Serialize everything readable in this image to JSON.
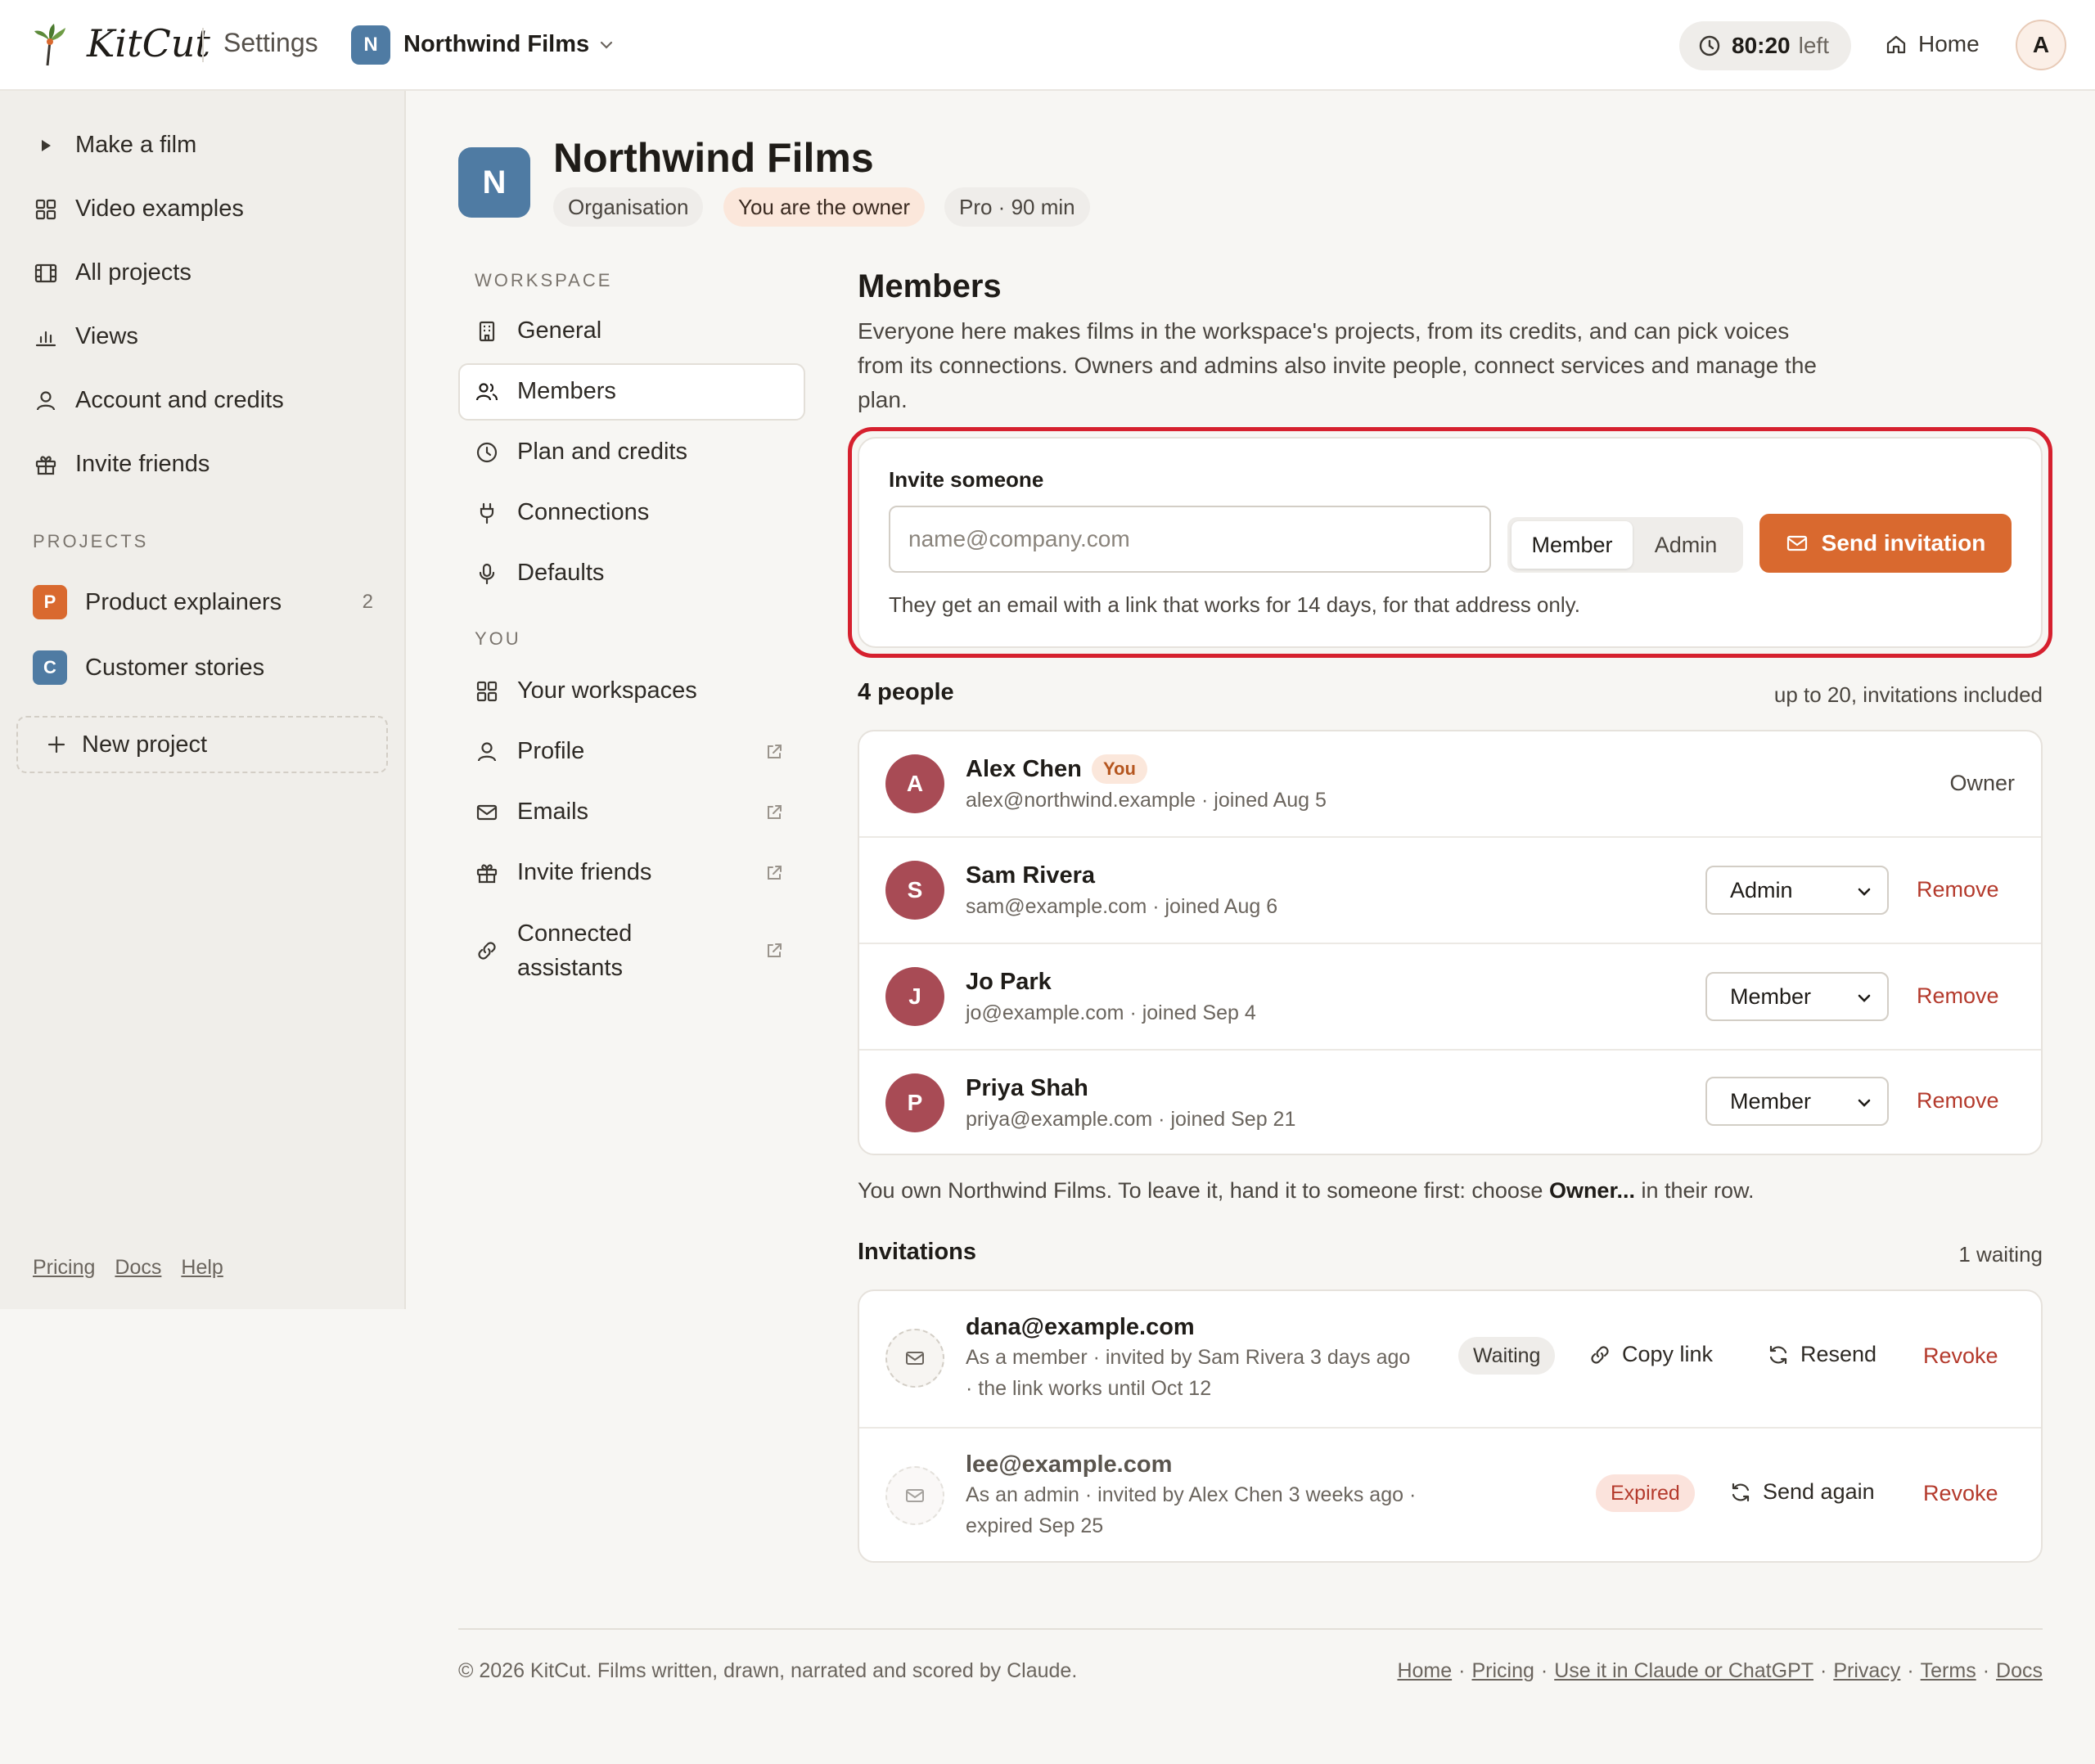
{
  "topbar": {
    "brand": "KitCut",
    "section": "Settings",
    "workspace_initial": "N",
    "workspace_name": "Northwind Films",
    "timer_value": "80:20",
    "timer_suffix": "left",
    "home_label": "Home",
    "avatar_initial": "A"
  },
  "sidebar": {
    "items": [
      {
        "label": "Make a film",
        "icon": "play-icon"
      },
      {
        "label": "Video examples",
        "icon": "grid-icon"
      },
      {
        "label": "All projects",
        "icon": "film-icon"
      },
      {
        "label": "Views",
        "icon": "bar-chart-icon"
      },
      {
        "label": "Account and credits",
        "icon": "user-icon"
      },
      {
        "label": "Invite friends",
        "icon": "gift-icon"
      }
    ],
    "projects_heading": "PROJECTS",
    "projects": [
      {
        "initial": "P",
        "label": "Product explainers",
        "count": "2",
        "color": "#d9692f"
      },
      {
        "initial": "C",
        "label": "Customer stories",
        "count": "",
        "color": "#4f7ba3"
      }
    ],
    "new_project_label": "New project",
    "footer_links": [
      "Pricing",
      "Docs",
      "Help"
    ]
  },
  "org": {
    "initial": "N",
    "name": "Northwind Films",
    "chips": [
      "Organisation",
      "You are the owner",
      "Pro · 90 min"
    ]
  },
  "settings_nav": {
    "workspace_heading": "WORKSPACE",
    "workspace_items": [
      {
        "label": "General",
        "icon": "building-icon"
      },
      {
        "label": "Members",
        "icon": "users-icon",
        "active": true
      },
      {
        "label": "Plan and credits",
        "icon": "clock-icon"
      },
      {
        "label": "Connections",
        "icon": "plug-icon"
      },
      {
        "label": "Defaults",
        "icon": "microphone-icon"
      }
    ],
    "you_heading": "YOU",
    "you_items": [
      {
        "label": "Your workspaces",
        "icon": "grid-icon"
      },
      {
        "label": "Profile",
        "icon": "user-icon",
        "external": true
      },
      {
        "label": "Emails",
        "icon": "mail-icon",
        "external": true
      },
      {
        "label": "Invite friends",
        "icon": "gift-icon",
        "external": true
      },
      {
        "label_line1": "Connected",
        "label_line2": "assistants",
        "icon": "link-icon",
        "external": true
      }
    ]
  },
  "members": {
    "title": "Members",
    "description": "Everyone here makes films in the workspace's projects, from its credits, and can pick voices from its connections. Owners and admins also invite people, connect services and manage the plan.",
    "invite": {
      "label": "Invite someone",
      "email_placeholder": "name@company.com",
      "email_value": "",
      "role_options": [
        "Member",
        "Admin"
      ],
      "selected_role": "Member",
      "send_label": "Send invitation",
      "help_text": "They get an email with a link that works for 14 days, for that address only."
    },
    "people_count_label": "4 people",
    "people_limit_label": "up to 20, invitations included",
    "list": [
      {
        "initial": "A",
        "name": "Alex Chen",
        "you_tag": "You",
        "meta": "alex@northwind.example · joined Aug 5",
        "role": "Owner"
      },
      {
        "initial": "S",
        "name": "Sam Rivera",
        "meta": "sam@example.com · joined Aug 6",
        "role": "Admin",
        "remove_label": "Remove"
      },
      {
        "initial": "J",
        "name": "Jo Park",
        "meta": "jo@example.com · joined Sep 4",
        "role": "Member",
        "remove_label": "Remove"
      },
      {
        "initial": "P",
        "name": "Priya Shah",
        "meta": "priya@example.com · joined Sep 21",
        "role": "Member",
        "remove_label": "Remove"
      }
    ],
    "owner_note_prefix": "You own Northwind Films. To leave it, hand it to someone first: choose ",
    "owner_note_bold": "Owner...",
    "owner_note_suffix": " in their row."
  },
  "invitations": {
    "title": "Invitations",
    "count_label": "1 waiting",
    "items": [
      {
        "email": "dana@example.com",
        "meta_line1": "As a member · invited by Sam Rivera 3 days ago",
        "meta_line2": "· the link works until Oct 12",
        "status": "Waiting",
        "copy_label": "Copy link",
        "resend_label": "Resend",
        "revoke_label": "Revoke"
      },
      {
        "email": "lee@example.com",
        "meta_line1": "As an admin · invited by Alex Chen 3 weeks ago ·",
        "meta_line2": "expired Sep 25",
        "status": "Expired",
        "send_again_label": "Send again",
        "revoke_label": "Revoke"
      }
    ]
  },
  "footer": {
    "copyright": "© 2026 KitCut. Films written, drawn, narrated and scored by Claude.",
    "links": [
      "Home",
      "Pricing",
      "Use it in Claude or ChatGPT",
      "Privacy",
      "Terms",
      "Docs"
    ]
  },
  "colors": {
    "accent": "#d9692f",
    "workspace_blue": "#4f7ba3",
    "avatar_red": "#a84b55",
    "danger": "#b43a2c",
    "highlight": "#d6202e"
  }
}
